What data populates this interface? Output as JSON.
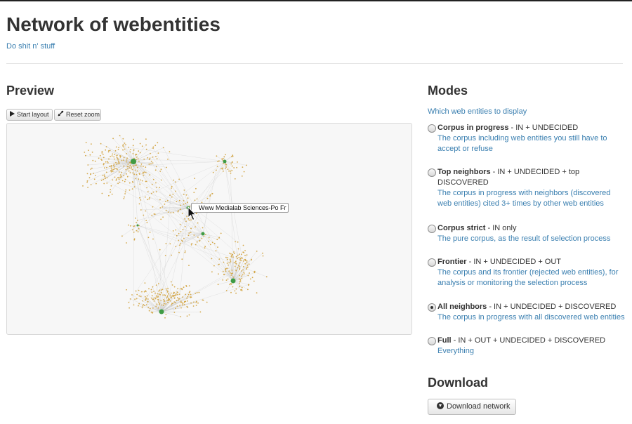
{
  "header": {
    "title": "Network of webentities",
    "subtitle": "Do shit n' stuff"
  },
  "preview": {
    "title": "Preview",
    "start_layout_label": "Start layout",
    "reset_zoom_label": "Reset zoom",
    "hovered_node_label": "Www Medialab Sciences-Po Fr",
    "colors": {
      "hub_node": "#3f9b43",
      "leaf_node": "#d4a84a",
      "edge": "#c8c8c8",
      "background": "#f7f7f7"
    }
  },
  "modes": {
    "title": "Modes",
    "subtitle": "Which web entities to display",
    "items": [
      {
        "name": "Corpus in progress",
        "rule": " - IN + UNDECIDED",
        "description": "The corpus including web entities you still have to accept or refuse",
        "selected": false
      },
      {
        "name": "Top neighbors",
        "rule": " - IN + UNDECIDED + top DISCOVERED",
        "description": "The corpus in progress with neighbors (discovered web entities) cited 3+ times by other web entities",
        "selected": false
      },
      {
        "name": "Corpus strict",
        "rule": " - IN only",
        "description": "The pure corpus, as the result of selection process",
        "selected": false
      },
      {
        "name": "Frontier",
        "rule": " - IN + UNDECIDED + OUT",
        "description": "The corpus and its frontier (rejected web entities), for analysis or monitoring the selection process",
        "selected": false
      },
      {
        "name": "All neighbors",
        "rule": " - IN + UNDECIDED + DISCOVERED",
        "description": "The corpus in progress with all discovered web entities",
        "selected": true
      },
      {
        "name": "Full",
        "rule": " - IN + OUT + UNDECIDED + DISCOVERED",
        "description": "Everything",
        "selected": false
      }
    ]
  },
  "download": {
    "title": "Download",
    "button_label": "Download network",
    "icon": "download-circle-icon"
  }
}
